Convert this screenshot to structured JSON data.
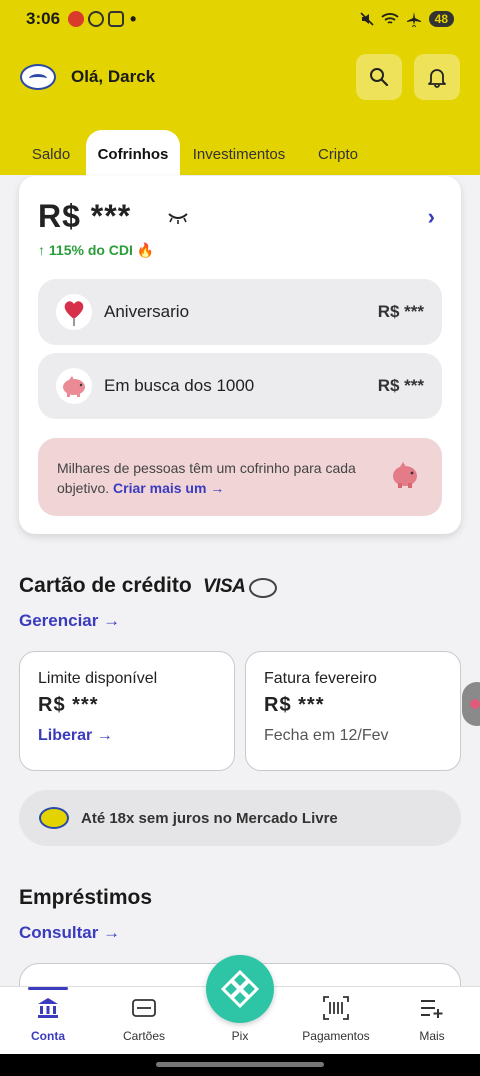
{
  "status_bar": {
    "time": "3:06",
    "dot": "•",
    "battery": "48"
  },
  "header": {
    "greeting": "Olá, Darck",
    "icons": [
      "mercado-pago-logo-icon",
      "search-icon",
      "bell-icon"
    ]
  },
  "tabs": [
    {
      "label": "Saldo",
      "active": false
    },
    {
      "label": "Cofrinhos",
      "active": true
    },
    {
      "label": "Investimentos",
      "active": false
    },
    {
      "label": "Cripto",
      "active": false
    }
  ],
  "cofrinhos": {
    "balance": "R$ ***",
    "cdi": "↑ 115% do CDI 🔥",
    "items": [
      {
        "name": "Aniversario",
        "value": "R$ ***",
        "icon": "balloon-heart-icon"
      },
      {
        "name": "Em busca dos 1000",
        "value": "R$ ***",
        "icon": "piggy-bank-icon"
      }
    ],
    "promo_text": "Milhares de pessoas têm um cofrinho para cada objetivo.",
    "promo_link": "Criar mais um →"
  },
  "credit": {
    "title": "Cartão de crédito",
    "brand": "VISA",
    "manage": "Gerenciar →",
    "limit_label": "Limite disponível",
    "limit_value": "R$ ***",
    "limit_action": "Liberar →",
    "invoice_label": "Fatura fevereiro",
    "invoice_value": "R$ ***",
    "invoice_sub": "Fecha em 12/Fev",
    "installments": "Até 18x sem juros no Mercado Livre"
  },
  "loans": {
    "title": "Empréstimos",
    "link": "Consultar →"
  },
  "bottom_nav": {
    "items": [
      {
        "label": "Conta",
        "icon": "bank-icon",
        "active": true
      },
      {
        "label": "Cartões",
        "icon": "card-icon",
        "active": false
      },
      {
        "label": "Pix",
        "icon": "pix-icon",
        "active": false
      },
      {
        "label": "Pagamentos",
        "icon": "barcode-icon",
        "active": false
      },
      {
        "label": "Mais",
        "icon": "list-plus-icon",
        "active": false
      }
    ]
  },
  "colors": {
    "header_yellow": "#e3d300",
    "accent_blue": "#3b3bbf",
    "cdi_green": "#2a9d3a",
    "pix_teal": "#2ec4a6",
    "promo_pink": "#f0d4d6"
  }
}
